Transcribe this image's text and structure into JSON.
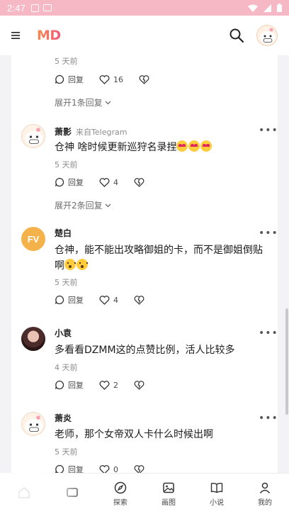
{
  "status_bar": {
    "time": "2:47"
  },
  "app": {
    "logo_text": "MD"
  },
  "comments": [
    {
      "id": "c0",
      "time": "5 天前",
      "reply_label": "回复",
      "likes": "16",
      "expand": "展开1条回复"
    },
    {
      "id": "c1",
      "name": "萧影",
      "source": "来自Telegram",
      "text": "仓神 啥时候更新巡狩名录捏",
      "time": "5 天前",
      "reply_label": "回复",
      "likes": "4",
      "expand": "展开2条回复"
    },
    {
      "id": "c2",
      "name": "楚白",
      "avatar_text": "FV",
      "text": "仓神，能不能出攻略御姐的卡，而不是御姐倒贴啊",
      "time": "5 天前",
      "reply_label": "回复",
      "likes": "4"
    },
    {
      "id": "c3",
      "name": "小袁",
      "text": "多看看DZMM这的点赞比例，活人比较多",
      "time": "4 天前",
      "reply_label": "回复",
      "likes": "2"
    },
    {
      "id": "c4",
      "name": "萧炎",
      "text": "老师，那个女帝双人卡什么时候出啊",
      "time": "5 天前",
      "reply_label": "回复",
      "likes": "0"
    }
  ],
  "bottom_nav": [
    {
      "label": "",
      "icon": "home-icon"
    },
    {
      "label": "",
      "icon": "message-icon"
    },
    {
      "label": "探索",
      "icon": "compass-icon"
    },
    {
      "label": "画图",
      "icon": "image-icon"
    },
    {
      "label": "小说",
      "icon": "book-icon"
    },
    {
      "label": "我的",
      "icon": "person-icon"
    }
  ],
  "colors": {
    "status_bar": "#f7b8c6",
    "logo_start": "#f4894e",
    "logo_end": "#f15a7a",
    "fv_avatar": "#f4b24a"
  }
}
